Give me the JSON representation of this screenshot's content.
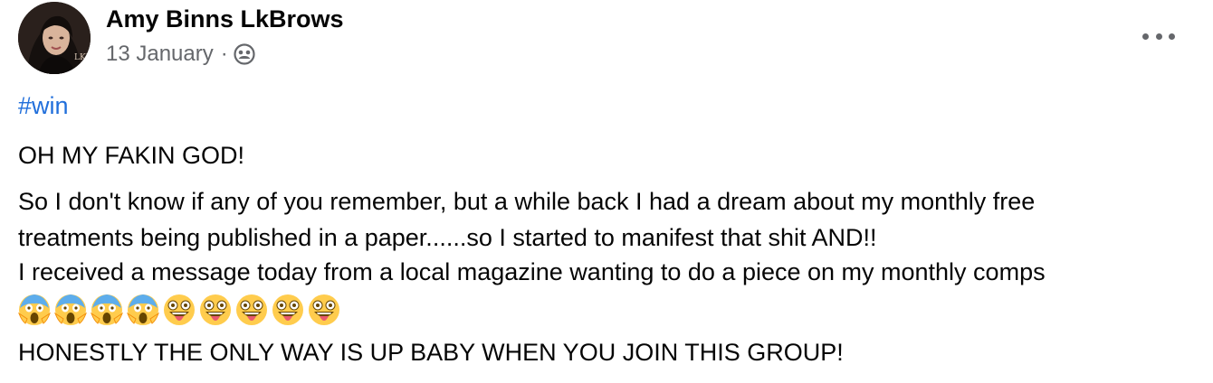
{
  "post": {
    "author": "Amy Binns LkBrows",
    "date": "13 January",
    "separator": "·",
    "privacy_icon": "group-icon",
    "avatar_text": "LKB",
    "more_icon": "more-options-icon",
    "hashtag": "#win",
    "paragraphs": [
      "OH MY FAKIN GOD!",
      "So I don't know if any of you remember, but a while back I had a dream about my monthly free",
      "treatments being published in a paper......so I started to manifest that shit AND!!",
      "I received a message today from a local magazine wanting to do a piece on my monthly comps",
      "HONESTLY THE ONLY WAY IS UP BABY WHEN YOU JOIN THIS GROUP!"
    ],
    "emojis": [
      "screaming-face",
      "screaming-face",
      "screaming-face",
      "screaming-face",
      "zany-face",
      "zany-face",
      "zany-face",
      "zany-face",
      "zany-face"
    ]
  }
}
